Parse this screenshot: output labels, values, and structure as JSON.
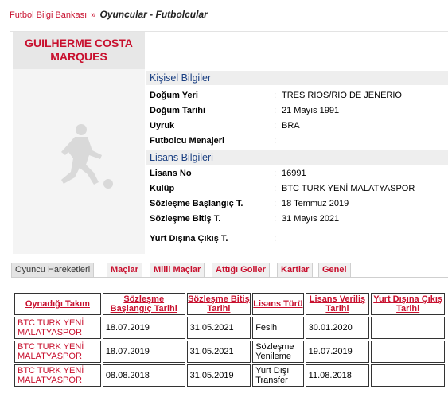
{
  "breadcrumb": {
    "root": "Futbol Bilgi Bankası",
    "separator": "»",
    "current": "Oyuncular - Futbolcular"
  },
  "player": {
    "name_line1": "GUILHERME COSTA",
    "name_line2": "MARQUES"
  },
  "personal": {
    "title": "Kişisel Bilgiler",
    "rows": [
      {
        "label": "Doğum Yeri",
        "value": "TRES RIOS/RIO DE JENERIO"
      },
      {
        "label": "Doğum Tarihi",
        "value": "21 Mayıs 1991"
      },
      {
        "label": "Uyruk",
        "value": "BRA"
      },
      {
        "label": "Futbolcu Menajeri",
        "value": ""
      }
    ]
  },
  "license": {
    "title": "Lisans Bilgileri",
    "rows": [
      {
        "label": "Lisans No",
        "value": "16991"
      },
      {
        "label": "Kulüp",
        "value": "BTC TURK YENİ MALATYASPOR"
      },
      {
        "label": "Sözleşme Başlangıç T.",
        "value": "18 Temmuz 2019"
      },
      {
        "label": "Sözleşme Bitiş T.",
        "value": "31 Mayıs 2021"
      },
      {
        "label": "Yurt Dışına Çıkış T.",
        "value": ""
      }
    ]
  },
  "tabs": [
    {
      "label": "Oyuncu Hareketleri",
      "active": true
    },
    {
      "label": "Maçlar",
      "active": false
    },
    {
      "label": "Milli Maçlar",
      "active": false
    },
    {
      "label": "Attığı Goller",
      "active": false
    },
    {
      "label": "Kartlar",
      "active": false
    },
    {
      "label": "Genel",
      "active": false
    }
  ],
  "table": {
    "headers": [
      "Oynadığı Takım",
      "Sözleşme Başlangıç Tarihi",
      "Sözleşme Bitiş Tarihi",
      "Lisans Türü",
      "Lisans Veriliş Tarihi",
      "Yurt Dışına Çıkış Tarihi"
    ],
    "rows": [
      [
        "BTC TURK YENİ MALATYASPOR",
        "18.07.2019",
        "31.05.2021",
        "Fesih",
        "30.01.2020",
        ""
      ],
      [
        "BTC TURK YENİ MALATYASPOR",
        "18.07.2019",
        "31.05.2021",
        "Sözleşme Yenileme",
        "19.07.2019",
        ""
      ],
      [
        "BTC TURK YENİ MALATYASPOR",
        "08.08.2018",
        "31.05.2019",
        "Yurt Dışı Transfer",
        "11.08.2018",
        ""
      ]
    ]
  },
  "icons": {
    "player_photo": "player-silhouette-icon"
  },
  "colors": {
    "accent": "#c8102e",
    "section_title": "#1a3f82"
  }
}
